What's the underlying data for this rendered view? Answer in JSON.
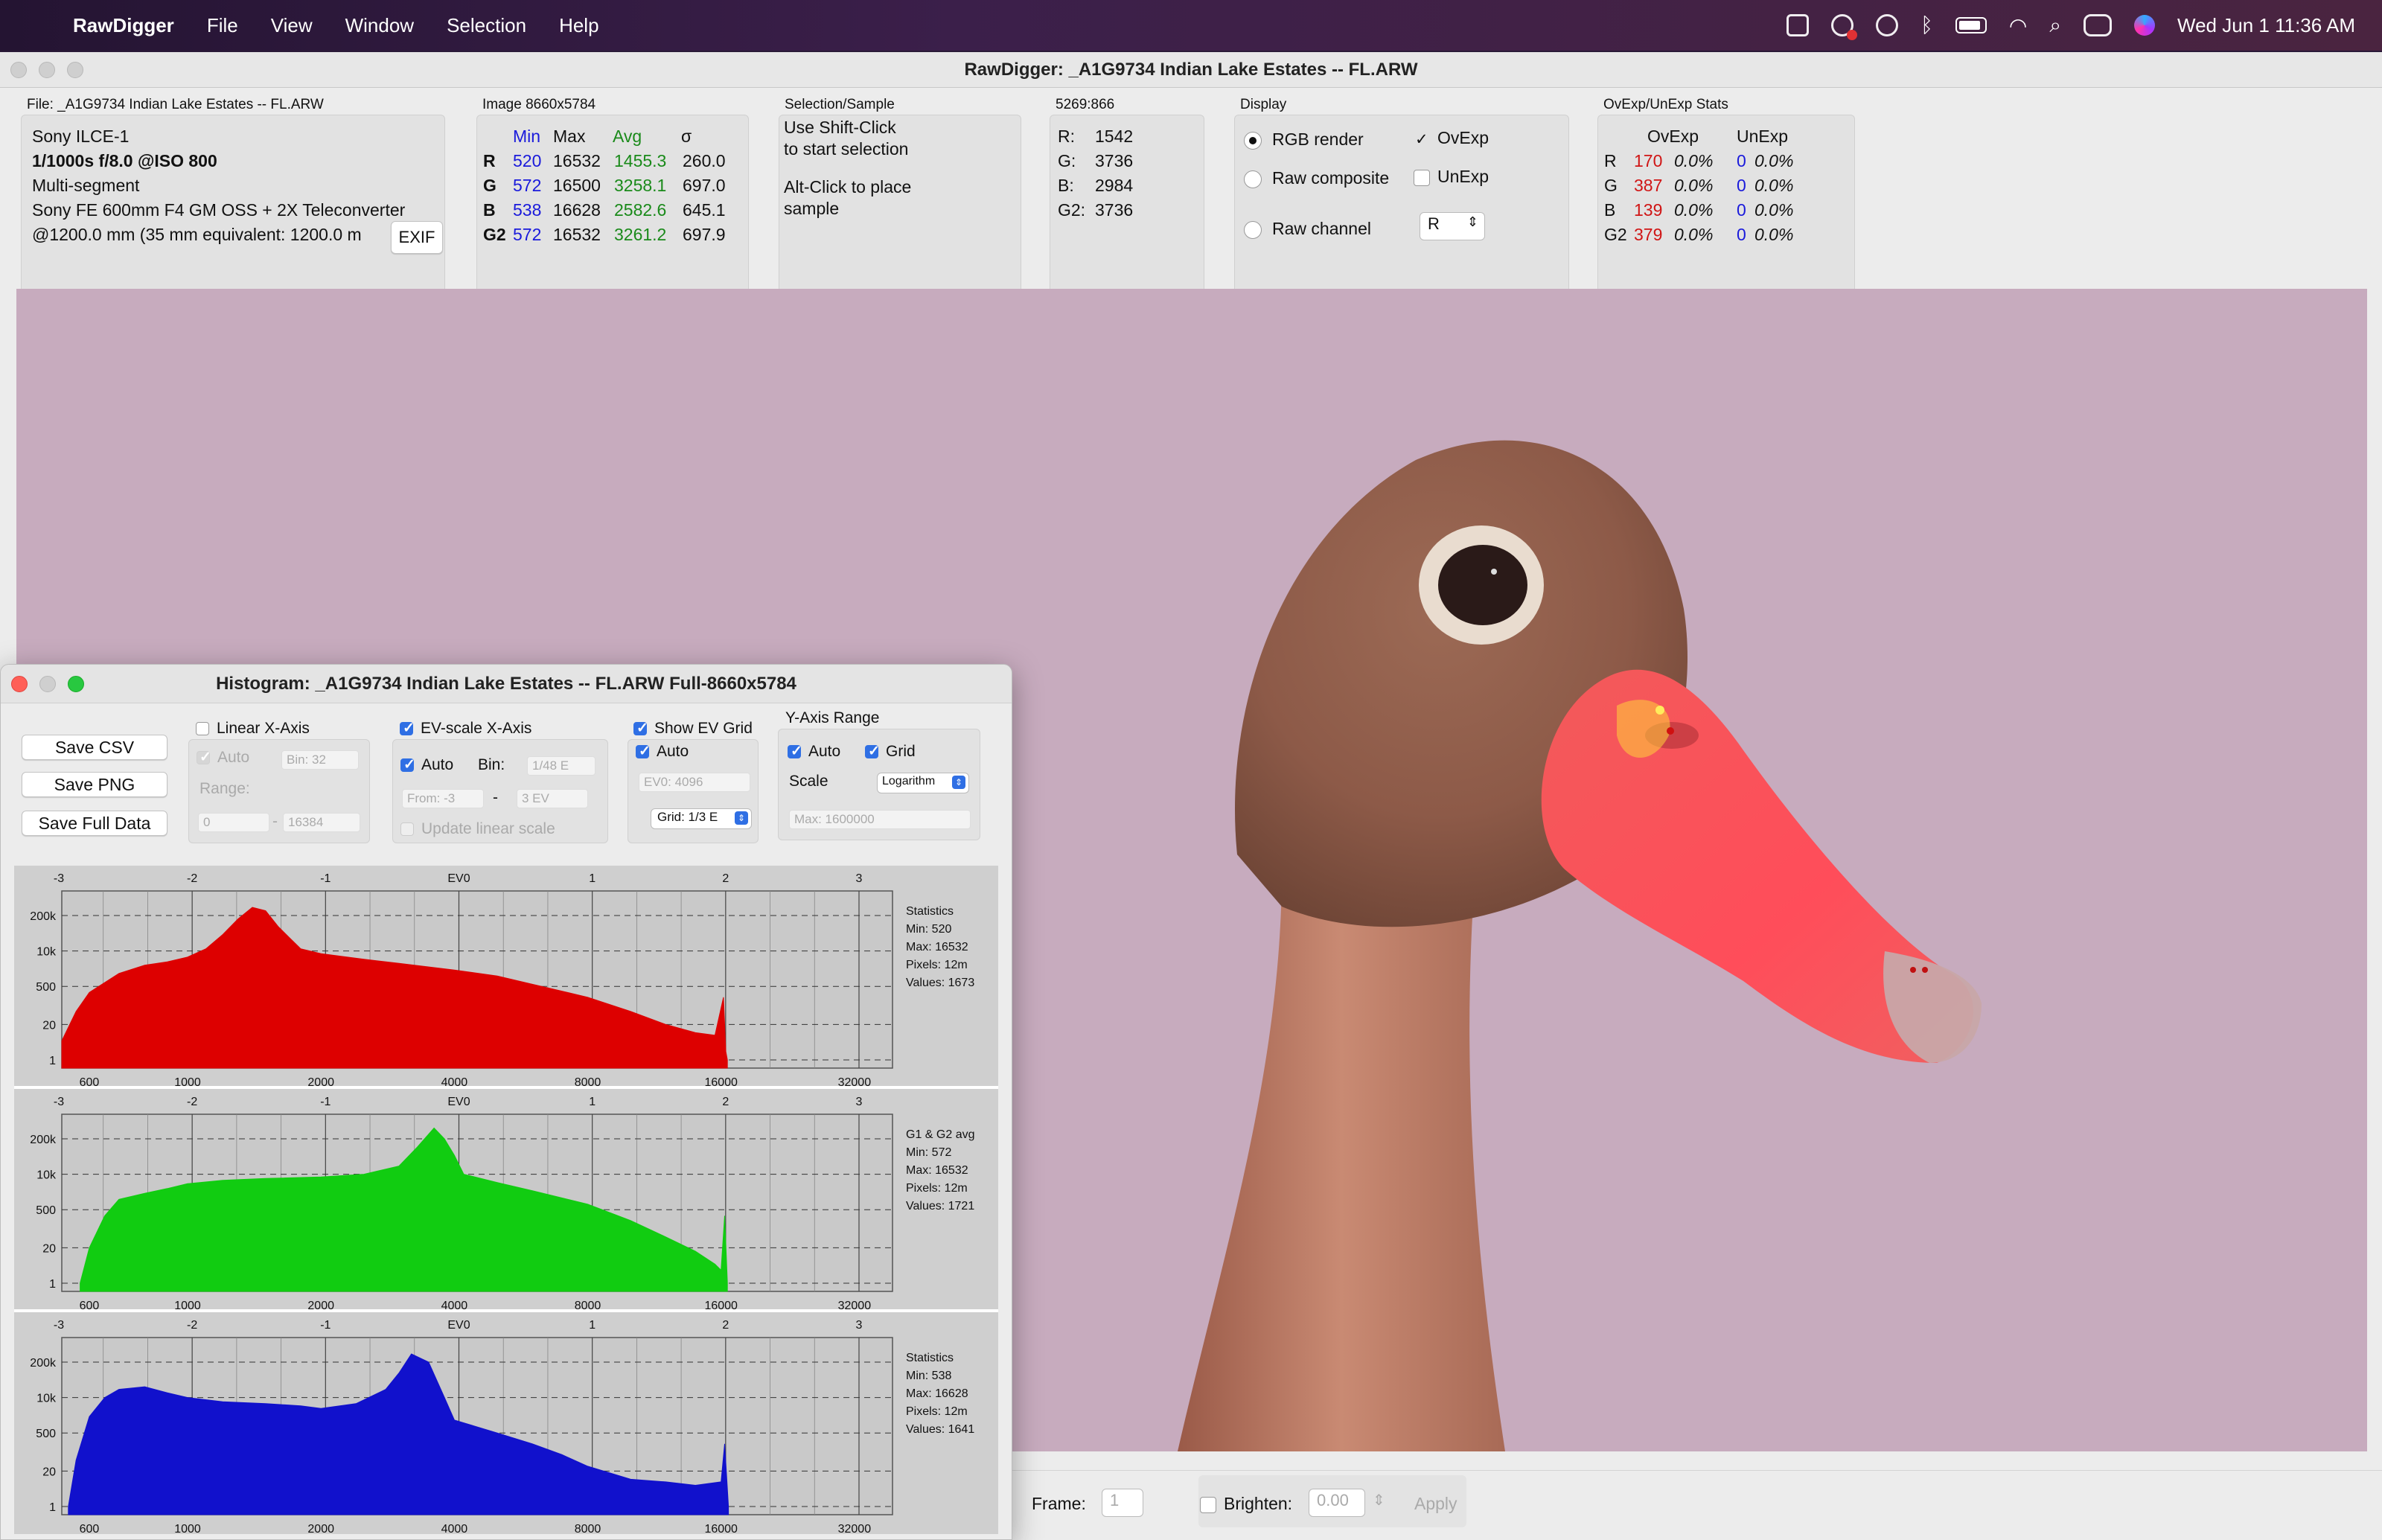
{
  "menubar": {
    "app": "RawDigger",
    "items": [
      "File",
      "View",
      "Window",
      "Selection",
      "Help"
    ],
    "datetime": "Wed Jun 1  11:36 AM"
  },
  "window": {
    "title": "RawDigger: _A1G9734 Indian Lake Estates --  FL.ARW"
  },
  "file": {
    "label": "File: _A1G9734 Indian Lake Estates --  FL.ARW",
    "camera": "Sony ILCE-1",
    "exposure": "1/1000s f/8.0 @ISO 800",
    "mode": "Multi-segment",
    "lens": "Sony FE 600mm F4 GM OSS + 2X Teleconverter",
    "focal": "@1200.0 mm (35 mm equivalent: 1200.0 m",
    "exif_button": "EXIF"
  },
  "image": {
    "label": "Image 8660x5784",
    "headers": [
      "Min",
      "Max",
      "Avg",
      "σ"
    ],
    "rows": [
      {
        "ch": "R",
        "min": "520",
        "max": "16532",
        "avg": "1455.3",
        "sd": "260.0"
      },
      {
        "ch": "G",
        "min": "572",
        "max": "16500",
        "avg": "3258.1",
        "sd": "697.0"
      },
      {
        "ch": "B",
        "min": "538",
        "max": "16628",
        "avg": "2582.6",
        "sd": "645.1"
      },
      {
        "ch": "G2",
        "min": "572",
        "max": "16532",
        "avg": "3261.2",
        "sd": "697.9"
      }
    ]
  },
  "selection": {
    "label": "Selection/Sample",
    "line1": "Use Shift-Click",
    "line2": "to start selection",
    "line3": "Alt-Click to place",
    "line4": "sample"
  },
  "coords": {
    "label": "5269:866",
    "rows": [
      {
        "k": "R:",
        "v": "1542"
      },
      {
        "k": "G:",
        "v": "3736"
      },
      {
        "k": "B:",
        "v": "2984"
      },
      {
        "k": "G2:",
        "v": "3736"
      }
    ]
  },
  "display": {
    "label": "Display",
    "rgb": "RGB render",
    "rawcomp": "Raw composite",
    "rawchan": "Raw channel",
    "ovexp": "OvExp",
    "unexp": "UnExp",
    "channel": "R"
  },
  "ovexp": {
    "label": "OvExp/UnExp Stats",
    "headers": [
      "OvExp",
      "UnExp"
    ],
    "rows": [
      {
        "ch": "R",
        "ov": "170",
        "ovp": "0.0%",
        "un": "0",
        "unp": "0.0%"
      },
      {
        "ch": "G",
        "ov": "387",
        "ovp": "0.0%",
        "un": "0",
        "unp": "0.0%"
      },
      {
        "ch": "B",
        "ov": "139",
        "ovp": "0.0%",
        "un": "0",
        "unp": "0.0%"
      },
      {
        "ch": "G2",
        "ov": "379",
        "ovp": "0.0%",
        "un": "0",
        "unp": "0.0%"
      }
    ]
  },
  "bottom": {
    "frame_label": "Frame:",
    "frame_value": "1",
    "brighten_label": "Brighten:",
    "brighten_value": "0.00",
    "apply": "Apply"
  },
  "histogram": {
    "title": "Histogram: _A1G9734 Indian Lake Estates --  FL.ARW Full-8660x5784",
    "save_csv": "Save CSV",
    "save_png": "Save PNG",
    "save_full": "Save Full Data",
    "linear_x": "Linear X-Axis",
    "auto": "Auto",
    "bin_val": "Bin: 32",
    "range": "Range:",
    "range_from": "0",
    "range_to": "16384",
    "ev_scale": "EV-scale X-Axis",
    "ev_auto": "Auto",
    "bin": "Bin:",
    "ev_bin": "1/48 E",
    "from": "From: -3",
    "to": "3 EV",
    "update_linear": "Update linear scale",
    "show_ev_grid": "Show EV Grid",
    "ev_grid_auto": "Auto",
    "ev0": "EV0: 4096",
    "grid": "Grid: 1/3 E",
    "y_range": "Y-Axis Range",
    "y_auto": "Auto",
    "y_grid": "Grid",
    "scale": "Scale",
    "scale_value": "Logarithm",
    "max": "Max: 1600000"
  },
  "chart_data": [
    {
      "type": "area",
      "name": "R",
      "color": "#dd0000",
      "ev_ticks": [
        "-3",
        "-2",
        "-1",
        "EV0",
        "1",
        "2",
        "3"
      ],
      "x_ticks": [
        "600",
        "1000",
        "2000",
        "4000",
        "8000",
        "16000",
        "32000"
      ],
      "y_ticks": [
        "200k",
        "10k",
        "500",
        "20",
        "1"
      ],
      "y_scale": "log",
      "x_scale": "log",
      "xlim": [
        520,
        39000
      ],
      "x": [
        520,
        560,
        600,
        700,
        800,
        900,
        1000,
        1100,
        1200,
        1300,
        1400,
        1500,
        1600,
        1700,
        1800,
        2000,
        2500,
        3000,
        4000,
        5000,
        6000,
        8000,
        10000,
        12000,
        14000,
        15500,
        16200,
        16400,
        16532
      ],
      "y": [
        5,
        60,
        300,
        1500,
        3000,
        4000,
        6000,
        12000,
        40000,
        150000,
        400000,
        300000,
        80000,
        30000,
        12000,
        8000,
        5000,
        3500,
        2000,
        1200,
        600,
        200,
        60,
        20,
        10,
        8,
        200,
        2,
        1
      ],
      "stats": {
        "title": "Statistics",
        "min": "Min: 520",
        "max": "Max: 16532",
        "pixels": "Pixels: 12m",
        "values": "Values: 1673"
      }
    },
    {
      "type": "area",
      "name": "G",
      "color": "#11cc11",
      "ev_ticks": [
        "-3",
        "-2",
        "-1",
        "EV0",
        "1",
        "2",
        "3"
      ],
      "x_ticks": [
        "600",
        "1000",
        "2000",
        "4000",
        "8000",
        "16000",
        "32000"
      ],
      "y_ticks": [
        "200k",
        "10k",
        "500",
        "20",
        "1"
      ],
      "y_scale": "log",
      "x_scale": "log",
      "xlim": [
        520,
        39000
      ],
      "x": [
        572,
        600,
        650,
        700,
        800,
        900,
        1000,
        1200,
        1500,
        2000,
        2500,
        3000,
        3300,
        3600,
        3800,
        4000,
        4200,
        5000,
        6000,
        8000,
        10000,
        12000,
        14000,
        15500,
        16000,
        16300,
        16532
      ],
      "y": [
        1,
        20,
        300,
        1200,
        2000,
        3000,
        4500,
        6000,
        7000,
        8000,
        10000,
        20000,
        100000,
        500000,
        200000,
        50000,
        10000,
        5000,
        2500,
        800,
        200,
        50,
        15,
        5,
        3,
        300,
        1
      ],
      "stats": {
        "title": "G1 & G2 avg",
        "min": "Min: 572",
        "max": "Max: 16532",
        "pixels": "Pixels: 12m",
        "values": "Values: 1721"
      }
    },
    {
      "type": "area",
      "name": "B",
      "color": "#1111cc",
      "ev_ticks": [
        "-3",
        "-2",
        "-1",
        "EV0",
        "1",
        "2",
        "3"
      ],
      "x_ticks": [
        "600",
        "1000",
        "2000",
        "4000",
        "8000",
        "16000",
        "32000"
      ],
      "y_ticks": [
        "200k",
        "10k",
        "500",
        "20",
        "1"
      ],
      "y_scale": "log",
      "x_scale": "log",
      "xlim": [
        520,
        39000
      ],
      "x": [
        538,
        560,
        600,
        650,
        700,
        800,
        900,
        1000,
        1200,
        1500,
        1800,
        2000,
        2400,
        2800,
        3000,
        3200,
        3500,
        3800,
        4000,
        5000,
        6000,
        7000,
        8000,
        10000,
        12000,
        14000,
        16000,
        16300,
        16628
      ],
      "y": [
        1,
        50,
        2000,
        10000,
        20000,
        25000,
        15000,
        10000,
        7000,
        6000,
        5000,
        4000,
        6000,
        20000,
        80000,
        400000,
        200000,
        10000,
        1500,
        500,
        200,
        80,
        30,
        10,
        8,
        6,
        8,
        200,
        1
      ],
      "stats": {
        "title": "Statistics",
        "min": "Min: 538",
        "max": "Max: 16628",
        "pixels": "Pixels: 12m",
        "values": "Values: 1641"
      }
    }
  ]
}
